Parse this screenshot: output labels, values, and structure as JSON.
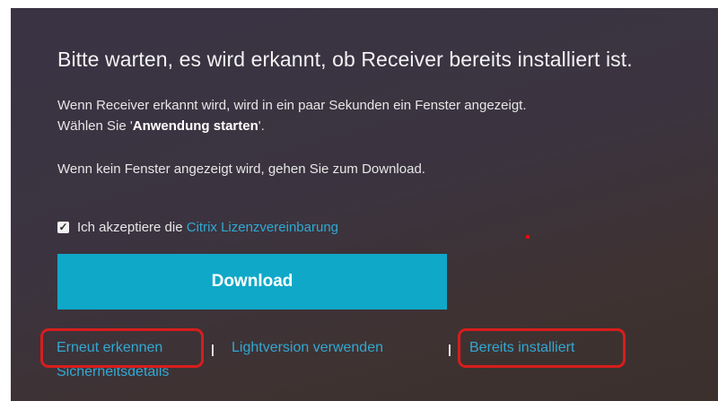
{
  "heading": "Bitte warten, es wird erkannt, ob Receiver bereits installiert ist.",
  "paragraph1_line1": "Wenn Receiver erkannt wird, wird in ein paar Sekunden ein Fenster angezeigt.",
  "paragraph1_line2_prefix": "Wählen Sie '",
  "paragraph1_line2_bold": "Anwendung starten",
  "paragraph1_line2_suffix": "'.",
  "paragraph2": "Wenn kein Fenster angezeigt wird, gehen Sie zum Download.",
  "license": {
    "checked": true,
    "label": "Ich akzeptiere die ",
    "link": "Citrix Lizenzvereinbarung"
  },
  "download_button": "Download",
  "links": {
    "redetect": "Erneut erkennen",
    "light_version": "Lightversion verwenden",
    "already_installed": "Bereits installiert",
    "security_details": "Sicherheitsdetails"
  },
  "separator": "|",
  "colors": {
    "accent": "#0fa8c8",
    "link": "#32a8d2",
    "highlight": "#d81d1d"
  }
}
